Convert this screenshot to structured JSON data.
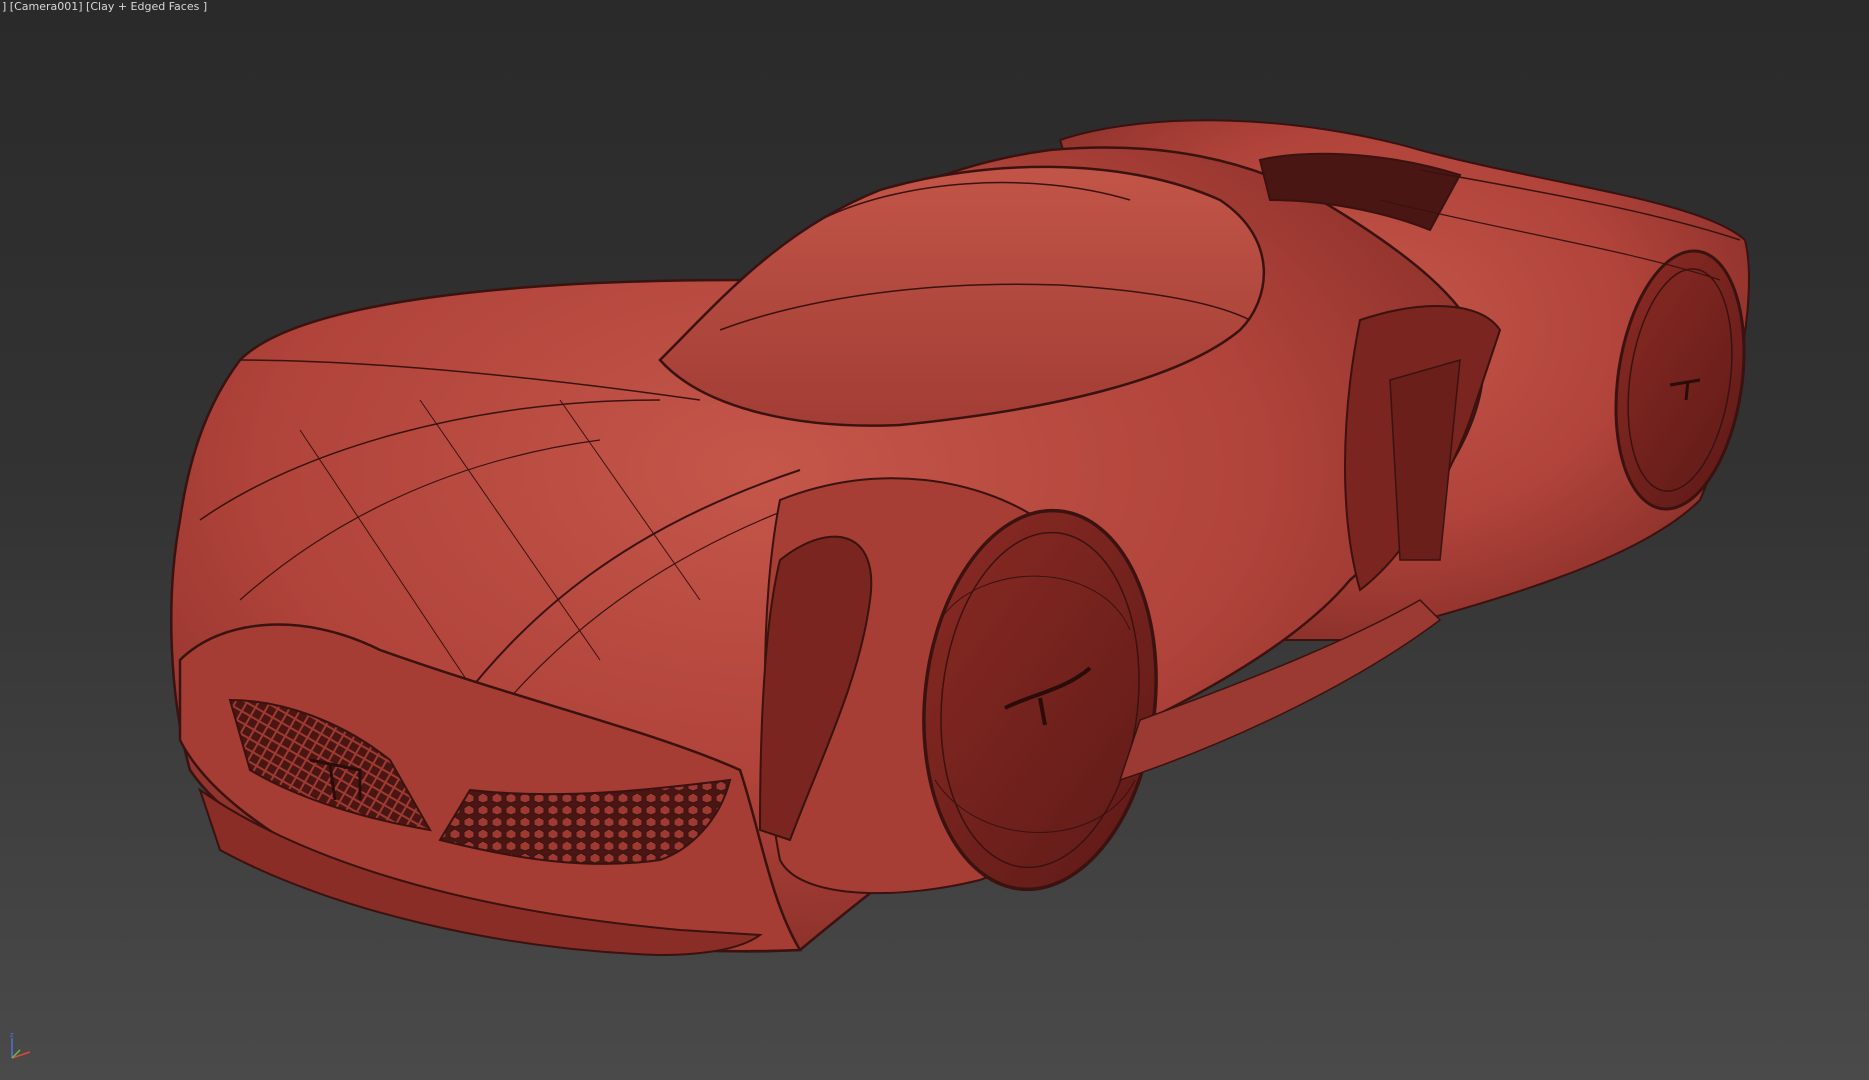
{
  "viewport": {
    "label_camera": "Camera001",
    "label_shading": "Clay + Edged Faces"
  },
  "gizmo": {
    "axis_z": "z",
    "colors": {
      "x": "#d94a3a",
      "y": "#5fbf4a",
      "z": "#4a74d9"
    }
  },
  "model": {
    "kind": "car-concept-mesh",
    "color_body": "#b8463c",
    "color_shadow": "#6e2420",
    "color_wire": "#3a1210"
  }
}
